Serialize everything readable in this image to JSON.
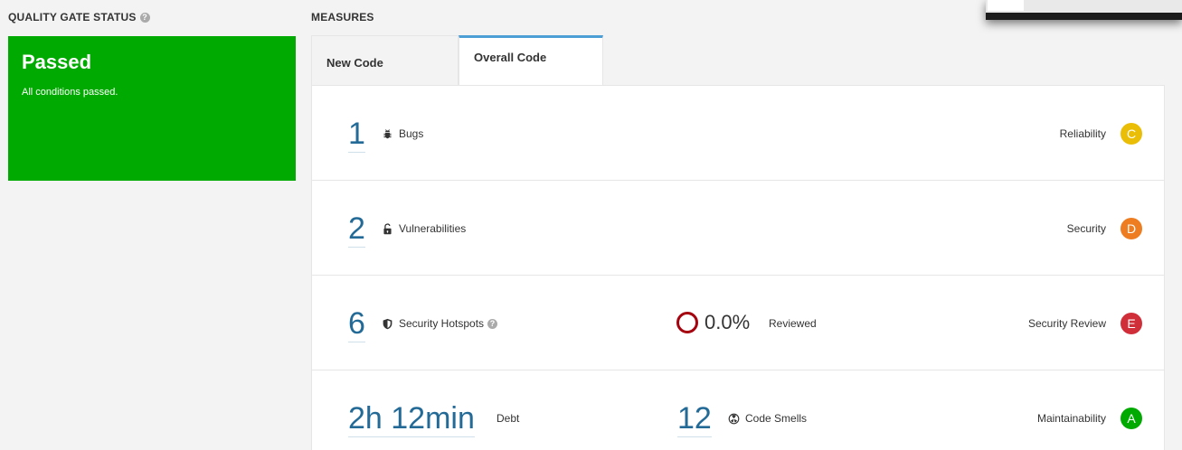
{
  "quality_gate": {
    "title": "QUALITY GATE STATUS",
    "status": "Passed",
    "description": "All conditions passed.",
    "color": "#00aa00"
  },
  "measures": {
    "title": "MEASURES",
    "tabs": [
      {
        "label": "New Code",
        "active": false
      },
      {
        "label": "Overall Code",
        "active": true
      }
    ],
    "rows": {
      "bugs": {
        "value": "1",
        "label": "Bugs",
        "rating_label": "Reliability",
        "rating": "C",
        "rating_color": "#eabe06"
      },
      "vulnerabilities": {
        "value": "2",
        "label": "Vulnerabilities",
        "rating_label": "Security",
        "rating": "D",
        "rating_color": "#ed7d20"
      },
      "hotspots": {
        "value": "6",
        "label": "Security Hotspots",
        "reviewed_pct": "0.0%",
        "reviewed_label": "Reviewed",
        "rating_label": "Security Review",
        "rating": "E",
        "rating_color": "#d02f3a"
      },
      "maintainability": {
        "debt_value": "2h 12min",
        "debt_label": "Debt",
        "smells_value": "12",
        "smells_label": "Code Smells",
        "rating_label": "Maintainability",
        "rating": "A",
        "rating_color": "#00aa00"
      }
    }
  },
  "icons": {
    "help": "help-icon",
    "bug": "bug-icon",
    "lock": "unlock-icon",
    "shield": "shield-icon",
    "smell": "code-smell-icon"
  }
}
